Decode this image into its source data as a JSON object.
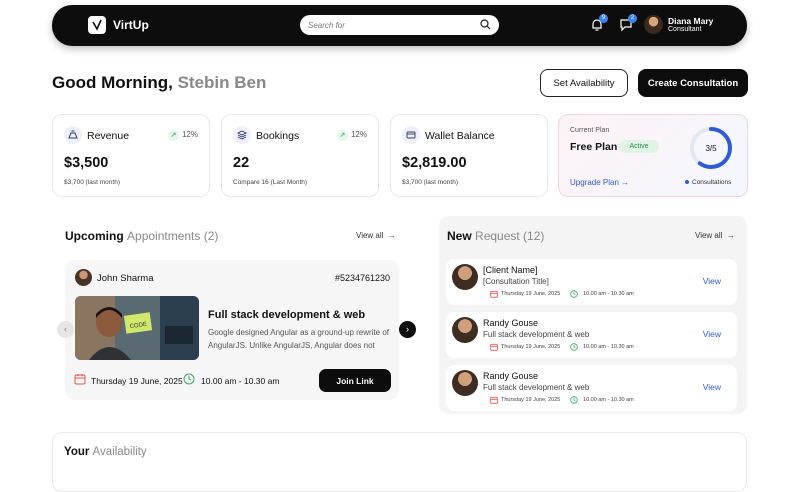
{
  "header": {
    "brand": "VirtUp",
    "search_placeholder": "Search for",
    "notifications_count": "9",
    "messages_count": "2",
    "user_name": "Diana Mary",
    "user_role": "Consultant"
  },
  "greeting": {
    "prefix": "Good Morning,",
    "name": "Stebin Ben"
  },
  "actions": {
    "set_availability": "Set Availability",
    "create_consultation": "Create Consultation"
  },
  "stats": [
    {
      "label": "Revenue",
      "trend": "12%",
      "value": "$3,500",
      "sub": "$3,700 (last month)",
      "icon": "money-bag-icon"
    },
    {
      "label": "Bookings",
      "trend": "12%",
      "value": "22",
      "sub": "Compare 16 (Last Month)",
      "icon": "stack-icon"
    },
    {
      "label": "Wallet Balance",
      "value": "$2,819.00",
      "sub": "$3,700 (last month)",
      "icon": "wallet-icon"
    }
  ],
  "plan": {
    "caption": "Current Plan",
    "name": "Free Plan",
    "status": "Active",
    "upgrade": "Upgrade Plan",
    "usage_text": "3/5",
    "usage_fraction": 0.6,
    "legend": "Consultations",
    "accent": "#2f5bd6"
  },
  "upcoming": {
    "title": "Upcoming",
    "title_muted": "Appointments (2)",
    "view_all": "View all",
    "card": {
      "person": "John Sharma",
      "id": "#5234761230",
      "course": "Full stack development & web",
      "desc": "Google designed Angular as a ground-up rewrite of AngularJS. Unlike AngularJS, Angular does not",
      "date": "Thursday 19 June, 2025",
      "time": "10.00 am - 10.30 am",
      "join": "Join Link",
      "thumb_note": "CODE"
    }
  },
  "requests": {
    "title": "New",
    "title_muted": "Request (12)",
    "view_all": "View all",
    "items": [
      {
        "name": "[Client Name]",
        "title": "[Consultation Title]",
        "date": "Thursday 19 June, 2025",
        "time": "10.00 am - 10.30 am",
        "action": "View"
      },
      {
        "name": "Randy Gouse",
        "title": "Full stack development & web",
        "date": "Thursday 19 June, 2025",
        "time": "10.00 am - 10.30 am",
        "action": "View"
      },
      {
        "name": "Randy Gouse",
        "title": "Full stack development & web",
        "date": "Thursday 19 June, 2025",
        "time": "10.00 am - 10.30 am",
        "action": "View"
      }
    ]
  },
  "availability": {
    "title": "Your",
    "title_muted": "Availability"
  }
}
